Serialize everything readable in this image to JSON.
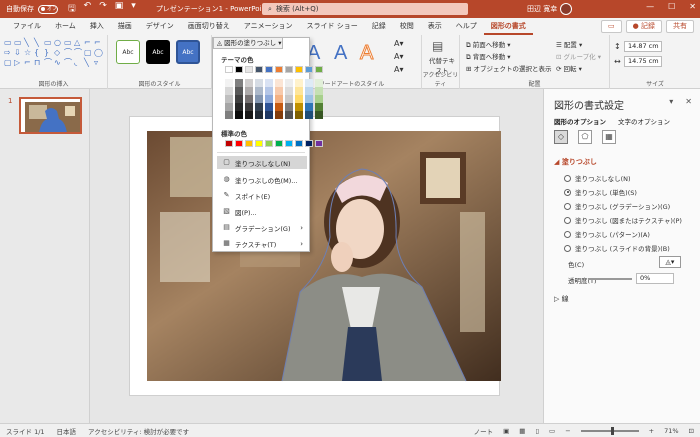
{
  "titlebar": {
    "autosave_label": "自動保存",
    "autosave_state": "オフ",
    "doc_title": "プレゼンテーション1 - PowerPoint",
    "search_placeholder": "検索 (Alt+Q)",
    "user_name": "田辺 寛幸",
    "accent": "#b7472a"
  },
  "tabs": [
    {
      "label": "ファイル"
    },
    {
      "label": "ホーム"
    },
    {
      "label": "挿入"
    },
    {
      "label": "描画"
    },
    {
      "label": "デザイン"
    },
    {
      "label": "画面切り替え"
    },
    {
      "label": "アニメーション"
    },
    {
      "label": "スライド ショー"
    },
    {
      "label": "記録"
    },
    {
      "label": "校閲"
    },
    {
      "label": "表示"
    },
    {
      "label": "ヘルプ"
    },
    {
      "label": "図形の書式"
    }
  ],
  "tab_buttons": {
    "record": "● 記録",
    "share": "共有"
  },
  "ribbon": {
    "groups": {
      "insert_shapes": "図形の挿入",
      "shape_styles": "図形のスタイル",
      "wordart_styles": "ワードアートのスタイル",
      "accessibility": "アクセシビリティ",
      "arrange": "配置",
      "size": "サイズ"
    },
    "style_label": "Abc",
    "fill_button": "図形の塗りつぶし",
    "alt_text": "代替テキスト",
    "arrange_items": [
      "前面へ移動",
      "背面へ移動",
      "オブジェクトの選択と表示"
    ],
    "arrange_right": [
      "配置",
      "グループ化",
      "回転"
    ],
    "height": "14.87 cm",
    "width": "14.75 cm"
  },
  "slide_number": "1",
  "format_pane": {
    "title": "図形の書式設定",
    "tab_shape": "図形のオプション",
    "tab_text": "文字のオプション",
    "section_fill": "塗りつぶし",
    "fill_options": [
      {
        "label": "塗りつぶしなし(N)",
        "selected": false
      },
      {
        "label": "塗りつぶし (単色)(S)",
        "selected": true
      },
      {
        "label": "塗りつぶし (グラデーション)(G)",
        "selected": false
      },
      {
        "label": "塗りつぶし (図またはテクスチャ)(P)",
        "selected": false
      },
      {
        "label": "塗りつぶし (パターン)(A)",
        "selected": false
      },
      {
        "label": "塗りつぶし (スライドの背景)(B)",
        "selected": false
      }
    ],
    "color_label": "色(C)",
    "transparency_label": "透明度(T)",
    "transparency_value": "0%",
    "section_line": "線"
  },
  "dropdown": {
    "theme_colors": "テーマの色",
    "standard_colors": "標準の色",
    "theme_row": [
      "#ffffff",
      "#000000",
      "#e7e6e6",
      "#44546a",
      "#4472c4",
      "#ed7d31",
      "#a5a5a5",
      "#ffc000",
      "#5b9bd5",
      "#70ad47"
    ],
    "theme_shades": [
      [
        "#f2f2f2",
        "#7f7f7f",
        "#d0cece",
        "#d6dce4",
        "#d9e2f3",
        "#fbe5d5",
        "#ededed",
        "#fff2cc",
        "#deebf6",
        "#e2efd9"
      ],
      [
        "#d8d8d8",
        "#595959",
        "#aeabab",
        "#adb9ca",
        "#b4c6e7",
        "#f7caac",
        "#dbdbdb",
        "#fee599",
        "#bdd7ee",
        "#c5e0b3"
      ],
      [
        "#bfbfbf",
        "#3f3f3f",
        "#757070",
        "#8496b0",
        "#8eaadb",
        "#f4b183",
        "#c9c9c9",
        "#ffd965",
        "#9cc3e5",
        "#a8d08d"
      ],
      [
        "#a5a5a5",
        "#262626",
        "#3a3838",
        "#323f4f",
        "#2f5496",
        "#c55a11",
        "#7b7b7b",
        "#bf9000",
        "#2e75b5",
        "#538135"
      ],
      [
        "#7f7f7f",
        "#0c0c0c",
        "#171616",
        "#222a35",
        "#1f3864",
        "#833c0b",
        "#525252",
        "#7f6000",
        "#1e4e79",
        "#375623"
      ]
    ],
    "standard_row": [
      "#c00000",
      "#ff0000",
      "#ffc000",
      "#ffff00",
      "#92d050",
      "#00b050",
      "#00b0f0",
      "#0070c0",
      "#002060",
      "#7030a0"
    ],
    "items": [
      {
        "label": "塗りつぶしなし(N)",
        "icon": "no-fill-icon"
      },
      {
        "label": "塗りつぶしの色(M)...",
        "icon": "palette-icon"
      },
      {
        "label": "スポイト(E)",
        "icon": "eyedropper-icon"
      },
      {
        "label": "図(P)...",
        "icon": "picture-icon"
      },
      {
        "label": "グラデーション(G)",
        "icon": "gradient-icon"
      },
      {
        "label": "テクスチャ(T)",
        "icon": "texture-icon"
      }
    ]
  },
  "status": {
    "slide": "スライド 1/1",
    "language": "日本語",
    "accessibility": "アクセシビリティ: 検討が必要です",
    "notes": "ノート",
    "zoom": "71%"
  }
}
